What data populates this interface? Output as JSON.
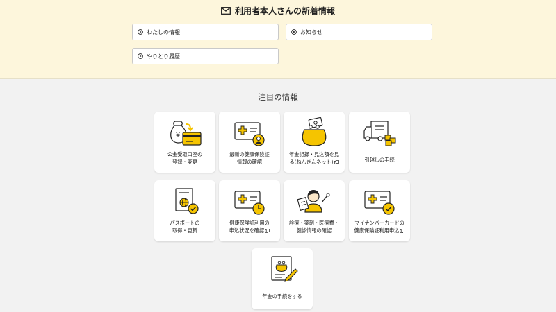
{
  "header": {
    "title": "利用者本人さんの新着情報",
    "links": [
      {
        "label": "わたしの情報"
      },
      {
        "label": "お知らせ"
      },
      {
        "label": "やりとり履歴"
      }
    ]
  },
  "featured": {
    "title": "注目の情報",
    "cards": [
      {
        "line1": "公金受取口座の",
        "line2": "登録・変更",
        "icon": "money-bag-card-icon"
      },
      {
        "line1": "最新の健康保険証",
        "line2": "情報の確認",
        "icon": "health-card-person-icon"
      },
      {
        "line1": "年金記録・見込額を見",
        "line2": "る(ねんきんネット)",
        "external": true,
        "icon": "coin-purse-money-icon"
      },
      {
        "line1": "引越しの手続",
        "line2": "",
        "icon": "moving-truck-icon"
      },
      {
        "line1": "パスポートの",
        "line2": "取得・更新",
        "icon": "passport-check-icon"
      },
      {
        "line1": "健康保険証利用の",
        "line2": "申込状況を確認",
        "external": true,
        "icon": "health-card-clock-icon"
      },
      {
        "line1": "診療・薬剤・医療費・",
        "line2": "健診情報の確認",
        "icon": "doctor-clipboard-icon"
      },
      {
        "line1": "マイナンバーカードの",
        "line2": "健康保険証利用申込",
        "external": true,
        "icon": "health-card-check-icon"
      },
      {
        "line1": "年金の手続をする",
        "line2": "",
        "icon": "pension-form-pen-icon"
      }
    ]
  },
  "colors": {
    "accent": "#f5c400",
    "top_bg": "#fdf6dc",
    "page_bg": "#f2f2f2"
  }
}
